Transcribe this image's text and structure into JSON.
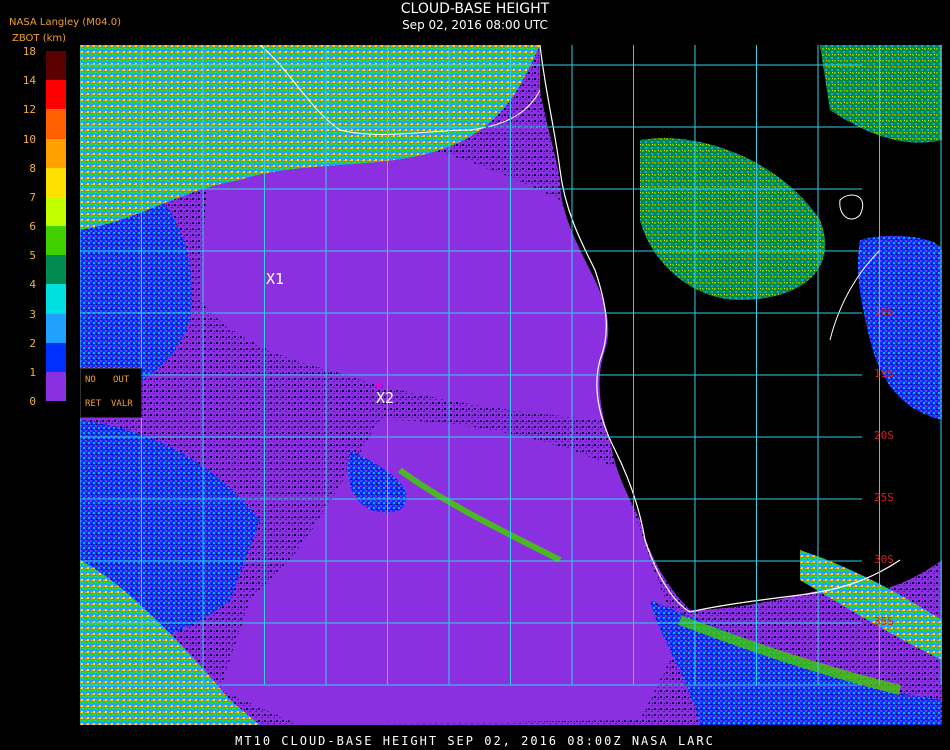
{
  "header": {
    "producer": "NASA Langley (M04.0)",
    "unit_label": "ZBOT (km)",
    "title": "CLOUD-BASE HEIGHT",
    "subtitle": "Sep 02, 2016 08:00 UTC"
  },
  "colorbar": {
    "ticks": [
      "18",
      "14",
      "12",
      "10",
      "8",
      "7",
      "6",
      "5",
      "4",
      "3",
      "2",
      "1",
      "0"
    ],
    "colors": [
      "#5a0000",
      "#ff0000",
      "#ff6000",
      "#ffa000",
      "#ffe000",
      "#c0ff00",
      "#40d000",
      "#008a50",
      "#00e0e0",
      "#20a0ff",
      "#0030ff",
      "#8a30e0"
    ]
  },
  "legend": {
    "no_label": "NO",
    "out_label": "OUT",
    "ret_label": "RET",
    "valr_label": "VALR"
  },
  "map": {
    "markers": [
      {
        "label": "X1"
      },
      {
        "label": "X2"
      }
    ],
    "lat_labels": [
      "10S",
      "15S",
      "20S",
      "25S",
      "30S",
      "35S"
    ],
    "colors": {
      "ocean_low": "#8a30e0",
      "clear": "#000000",
      "grid": "#30d0e8",
      "coast": "#ffffff",
      "marker": "#e000e0"
    }
  },
  "footer": {
    "text": "MT10  CLOUD-BASE HEIGHT  SEP 02, 2016 08:00Z  NASA LARC"
  }
}
